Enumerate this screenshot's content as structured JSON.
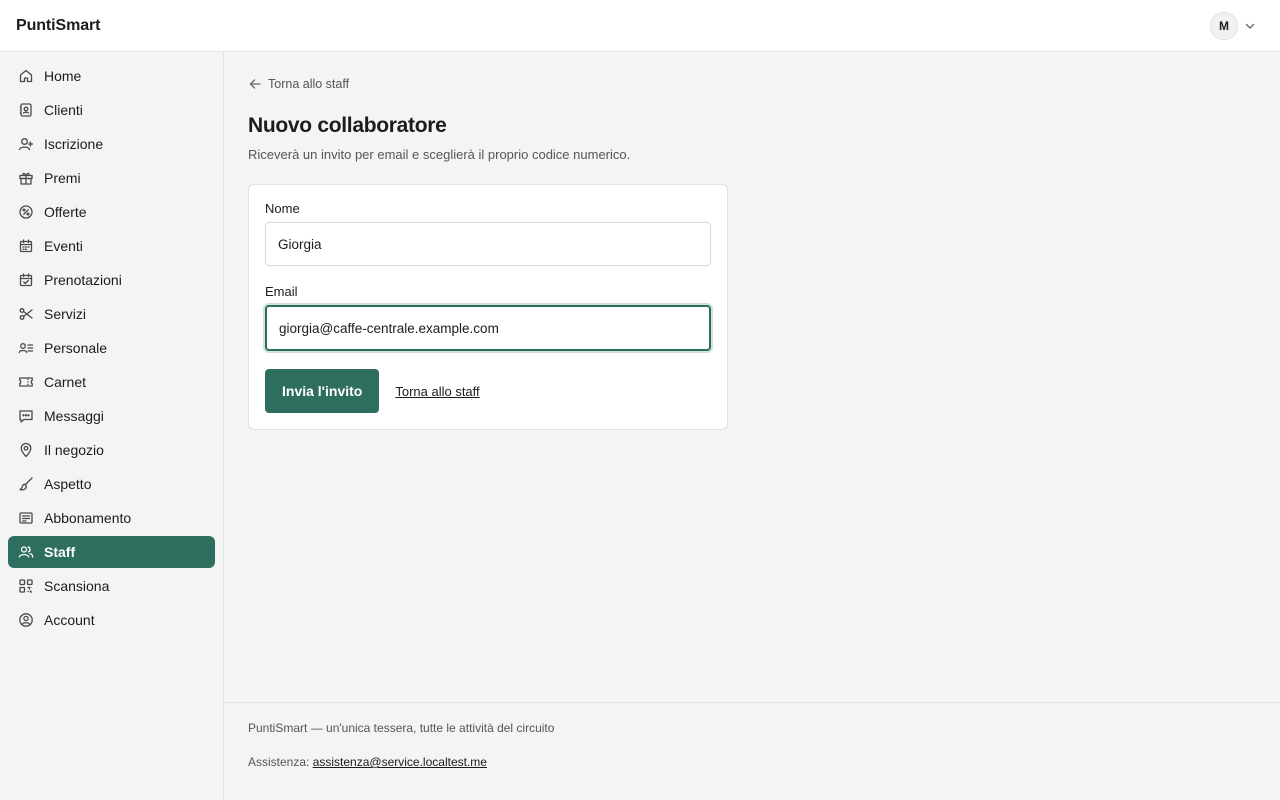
{
  "app": {
    "brand": "PuntiSmart"
  },
  "user": {
    "initial": "M"
  },
  "sidebar": {
    "items": [
      {
        "label": "Home",
        "icon": "home-icon",
        "active": false
      },
      {
        "label": "Clienti",
        "icon": "contacts-icon",
        "active": false
      },
      {
        "label": "Iscrizione",
        "icon": "user-plus-icon",
        "active": false
      },
      {
        "label": "Premi",
        "icon": "gift-icon",
        "active": false
      },
      {
        "label": "Offerte",
        "icon": "percent-badge-icon",
        "active": false
      },
      {
        "label": "Eventi",
        "icon": "calendar-icon",
        "active": false
      },
      {
        "label": "Prenotazioni",
        "icon": "calendar-check-icon",
        "active": false
      },
      {
        "label": "Servizi",
        "icon": "scissors-icon",
        "active": false
      },
      {
        "label": "Personale",
        "icon": "user-list-icon",
        "active": false
      },
      {
        "label": "Carnet",
        "icon": "ticket-icon",
        "active": false
      },
      {
        "label": "Messaggi",
        "icon": "message-icon",
        "active": false
      },
      {
        "label": "Il negozio",
        "icon": "map-pin-icon",
        "active": false
      },
      {
        "label": "Aspetto",
        "icon": "brush-icon",
        "active": false
      },
      {
        "label": "Abbonamento",
        "icon": "receipt-icon",
        "active": false
      },
      {
        "label": "Staff",
        "icon": "users-icon",
        "active": true
      },
      {
        "label": "Scansiona",
        "icon": "qr-code-icon",
        "active": false
      },
      {
        "label": "Account",
        "icon": "user-circle-icon",
        "active": false
      }
    ]
  },
  "page": {
    "back_label": "Torna allo staff",
    "title": "Nuovo collaboratore",
    "subtitle": "Riceverà un invito per email e sceglierà il proprio codice numerico."
  },
  "form": {
    "name_label": "Nome",
    "name_value": "Giorgia",
    "email_label": "Email",
    "email_value": "giorgia@caffe-centrale.example.com",
    "submit_label": "Invia l'invito",
    "cancel_label": "Torna allo staff"
  },
  "footer": {
    "tagline": "PuntiSmart — un'unica tessera, tutte le attività del circuito",
    "support_label": "Assistenza:",
    "support_email": "assistenza@service.localtest.me"
  },
  "colors": {
    "accent": "#2e6e5f",
    "background": "#f4f4f4"
  }
}
